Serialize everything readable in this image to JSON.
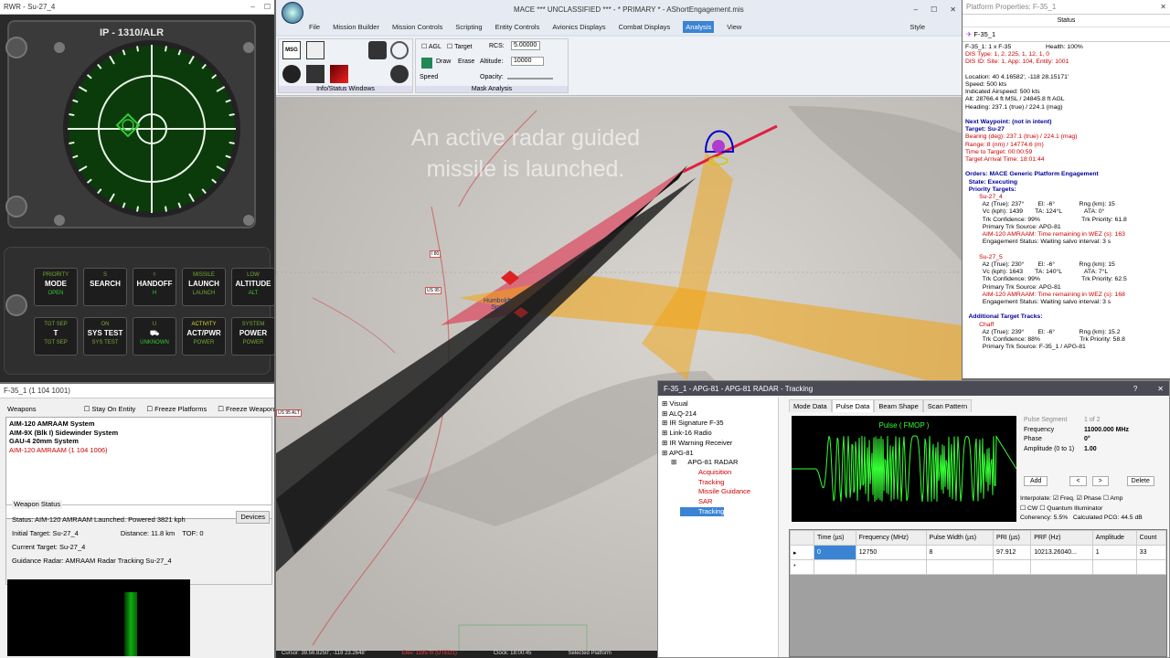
{
  "rwr": {
    "title": "RWR - Su-27_4",
    "panel_title": "IP - 1310/ALR",
    "buttons": [
      [
        "PRIORITY",
        "MODE",
        "OPEN"
      ],
      [
        "S",
        "SEARCH",
        ""
      ],
      [
        "◊",
        "HANDOFF",
        "H"
      ],
      [
        "MISSILE",
        "LAUNCH",
        "LAUNCH"
      ],
      [
        "LOW",
        "ALTITUDE",
        "ALT"
      ],
      [
        "TGT SEP",
        "T",
        "TGT SEP"
      ],
      [
        "ON",
        "SYS TEST",
        "SYS TEST"
      ],
      [
        "U",
        "⛟",
        "UNKNOWN"
      ],
      [
        "ACTIVITY",
        "ACT/PWR",
        "POWER"
      ],
      [
        "SYSTEM",
        "POWER",
        "POWER"
      ]
    ]
  },
  "weapons": {
    "title": "F-35_1 (1 104 1001)",
    "label": "Weapons",
    "stay": "Stay On Entity",
    "freeze_plat": "Freeze Platforms",
    "freeze_weap": "Freeze Weapon",
    "items": [
      "AIM-120 AMRAAM System",
      "AIM-9X (Blk I) Sidewinder System",
      "GAU-4 20mm System"
    ],
    "active_item": "AIM-120 AMRAAM (1 104 1006)",
    "status_label": "Weapon Status",
    "status": "Status: AIM-120 AMRAAM Launched. Powered 3821 kph",
    "devices": "Devices",
    "initial_target": "Initial Target: Su-27_4",
    "distance": "Distance: 11.8 km",
    "tof": "TOF: 0",
    "current_target": "Current Target: Su-27_4",
    "guidance": "Guidance Radar: AMRAAM Radar Tracking Su-27_4"
  },
  "main": {
    "title": "MACE *** UNCLASSIFIED *** - * PRIMARY * - AShortEngagement.mis",
    "style": "Style",
    "menu": [
      "File",
      "Mission Builder",
      "Mission Controls",
      "Scripting",
      "Entity Controls",
      "Avionics Displays",
      "Combat Displays",
      "Analysis",
      "View"
    ],
    "ribbon": {
      "g1": "Info/Status Windows",
      "g2": "Mask Analysis",
      "agl": "AGL",
      "target": "Target",
      "rcs": "RCS:",
      "rcs_val": "5.00000",
      "draw": "Draw",
      "erase": "Erase",
      "altitude": "Altitude:",
      "alt_val": "10000",
      "speed": "Speed",
      "opacity": "Opacity:"
    },
    "caption": "An active radar guided missile is launched.",
    "map_labels": {
      "humboldt": "Humboldt Sink",
      "us95": "US 95",
      "i80": "I 80",
      "alt": "US 95 ALT"
    },
    "status": {
      "cursor": "Cursor: 39.56.8250', -118 23.2648'",
      "elev": "Elev: 1185 m (DTED1)",
      "clock": "Clock: 18:00:45",
      "selected": "Selected Platform"
    }
  },
  "platform": {
    "title": "Platform Properties: F-35_1",
    "status_col": "Status",
    "entity": "F-35_1",
    "lines": [
      {
        "t": "F-35_1: 1 x F-35                    Health: 100%",
        "c": ""
      },
      {
        "t": "DIS Type: 1, 2, 225, 1, 12, 1, 0",
        "c": "red"
      },
      {
        "t": "DIS ID: Site: 1, App: 104, Entity: 1001",
        "c": "red"
      },
      {
        "t": " ",
        "c": ""
      },
      {
        "t": "Location: 40 4.16582', -118 28.15171'",
        "c": ""
      },
      {
        "t": "Speed: 500 kts",
        "c": ""
      },
      {
        "t": "Indicated Airspeed: 500 kts",
        "c": ""
      },
      {
        "t": "Alt: 28766.4 ft MSL / 24845.8 ft AGL",
        "c": ""
      },
      {
        "t": "Heading: 237.1 (true) / 224.1 (mag)",
        "c": ""
      },
      {
        "t": " ",
        "c": ""
      },
      {
        "t": "Next Waypoint: (not in intent)",
        "c": "b"
      },
      {
        "t": "Target: Su-27",
        "c": "b"
      },
      {
        "t": "Bearing (deg): 237.1 (true) / 224.1 (mag)",
        "c": "red"
      },
      {
        "t": "Range: 8 (nm) / 14774.6 (m)",
        "c": "red"
      },
      {
        "t": "Time to Target: 00:00:59",
        "c": "red"
      },
      {
        "t": "Target Arrival Time: 18:01:44",
        "c": "red"
      },
      {
        "t": " ",
        "c": ""
      },
      {
        "t": "Orders: MACE Generic Platform Engagement",
        "c": "b"
      },
      {
        "t": "  State: Executing",
        "c": "b"
      },
      {
        "t": "  Priority Targets:",
        "c": "b"
      },
      {
        "t": "        Su-27_4",
        "c": "red"
      },
      {
        "t": "          Az (True): 237°        El: -6°              Rng (km): 15",
        "c": ""
      },
      {
        "t": "          Vc (kph): 1439       TA: 124°L             ATA: 0°",
        "c": ""
      },
      {
        "t": "          Trk Confidence: 99%                        Trk Priority: 61.8",
        "c": ""
      },
      {
        "t": "          Primary Trk Source: APG-81",
        "c": ""
      },
      {
        "t": "          AIM-120 AMRAAM: Time remaining in WEZ (s): 163",
        "c": "red"
      },
      {
        "t": "          Engagement Status: Waiting salvo interval: 3 s",
        "c": ""
      },
      {
        "t": " ",
        "c": ""
      },
      {
        "t": "        Su-27_5",
        "c": "red"
      },
      {
        "t": "          Az (True): 230°        El: -6°              Rng (km): 15",
        "c": ""
      },
      {
        "t": "          Vc (kph): 1643       TA: 140°L             ATA: 7°L",
        "c": ""
      },
      {
        "t": "          Trk Confidence: 99%                        Trk Priority: 62.5",
        "c": ""
      },
      {
        "t": "          Primary Trk Source: APG-81",
        "c": ""
      },
      {
        "t": "          AIM-120 AMRAAM: Time remaining in WEZ (s): 168",
        "c": "red"
      },
      {
        "t": "          Engagement Status: Waiting salvo interval: 3 s",
        "c": ""
      },
      {
        "t": " ",
        "c": ""
      },
      {
        "t": "  Additional Target Tracks:",
        "c": "b"
      },
      {
        "t": "        Chaff",
        "c": "red"
      },
      {
        "t": "          Az (True): 239°        El: -6°              Rng (km): 15.2",
        "c": ""
      },
      {
        "t": "          Trk Confidence: 88%                       Trk Priority: 58.8",
        "c": ""
      },
      {
        "t": "          Primary Trk Source: F-35_1 / APG-81",
        "c": ""
      }
    ]
  },
  "tracking": {
    "title": "F-35_1 - APG-81 - APG-81 RADAR - Tracking",
    "tree": [
      "Visual",
      "ALQ-214",
      "IR Signature F-35",
      "Link-16 Radio",
      "IR Warning Receiver",
      "APG-81",
      "APG-81 RADAR",
      "Acquisition",
      "Tracking",
      "Missile Guidance",
      "SAR",
      "Tracking"
    ],
    "tabs": [
      "Mode Data",
      "Pulse Data",
      "Beam Shape",
      "Scan Pattern"
    ],
    "scope_label": "Pulse ( FMOP )",
    "seg_label": "Pulse Segment",
    "seg_val": "1 of 2",
    "freq_label": "Frequency",
    "freq_val": "11000.000 MHz",
    "phase_label": "Phase",
    "phase_val": "0°",
    "amp_label": "Amplitude (0 to 1)",
    "amp_val": "1.00",
    "add": "Add",
    "prev": "<",
    "next": ">",
    "delete": "Delete",
    "interp": "Interpolate:",
    "freq_cb": "Freq.",
    "phase_cb": "Phase",
    "amp_cb": "Amp",
    "cw": "CW",
    "qi": "Quantum Illuminator",
    "coh": "Coherency: 5.5%",
    "pcg": "Calculated PCG: 44.5 dB",
    "cols": [
      "Time (µs)",
      "Frequency (MHz)",
      "Pulse Width (µs)",
      "PRI (µs)",
      "PRF (Hz)",
      "Amplitude",
      "Count"
    ],
    "row": [
      "0",
      "12750",
      "8",
      "97.912",
      "10213.26040...",
      "1",
      "33"
    ]
  }
}
